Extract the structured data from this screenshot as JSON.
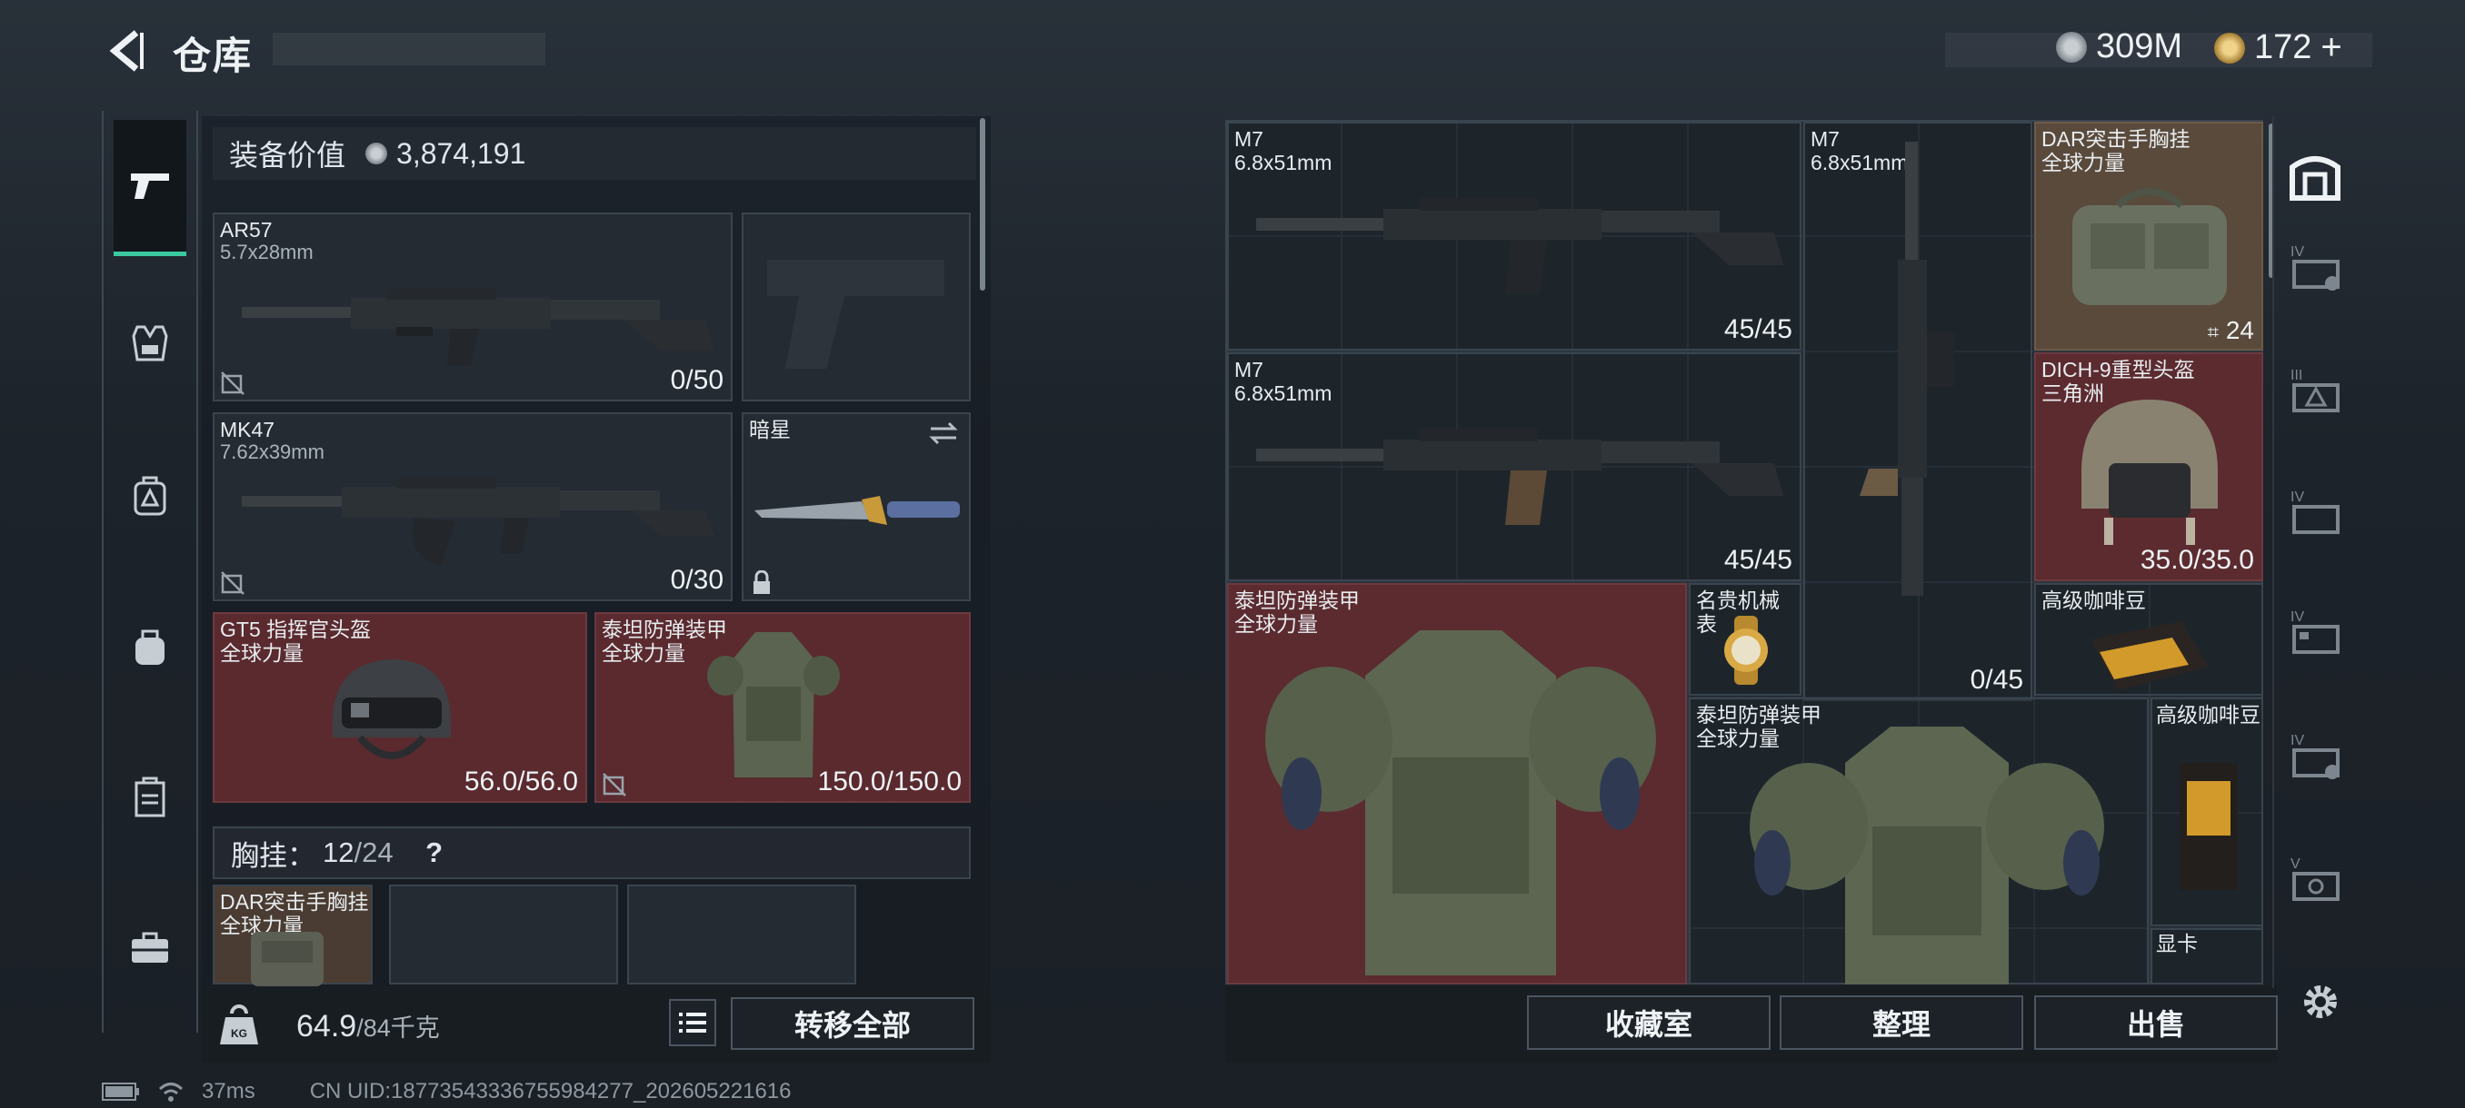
{
  "header": {
    "title": "仓库",
    "silver": "309M",
    "gold": "172"
  },
  "nav": {
    "items": [
      "weapons",
      "armor",
      "backpack",
      "bag",
      "locker",
      "case"
    ]
  },
  "equipment": {
    "label": "装备价值",
    "value": "3,874,191"
  },
  "slots": {
    "primary1": {
      "name": "AR57",
      "ammo": "5.7x28mm",
      "value": "0/50"
    },
    "primary2": {
      "name": "MK47",
      "ammo": "7.62x39mm",
      "value": "0/30"
    },
    "melee": {
      "name": "暗星"
    },
    "helmet": {
      "name": "GT5 指挥官头盔",
      "faction": "全球力量",
      "value": "56.0/56.0"
    },
    "armor": {
      "name": "泰坦防弹装甲",
      "faction": "全球力量",
      "value": "150.0/150.0"
    }
  },
  "rig": {
    "label": "胸挂：",
    "used": "12",
    "total": "/24",
    "help": "?",
    "item_name": "DAR突击手胸挂",
    "item_faction": "全球力量"
  },
  "bottom": {
    "weight": "64.9",
    "weight_max": "/84千克",
    "transfer": "转移全部"
  },
  "storage": {
    "m7a": {
      "name": "M7",
      "ammo": "6.8x51mm",
      "value": "45/45"
    },
    "m7b": {
      "name": "M7",
      "ammo": "6.8x51mm",
      "value": "45/45"
    },
    "m7v": {
      "name": "M7",
      "ammo": "6.8x51mm",
      "value": "0/45"
    },
    "dar": {
      "name": "DAR突击手胸挂",
      "faction": "全球力量",
      "value": "24"
    },
    "dich": {
      "name": "DICH-9重型头盔",
      "faction": "三角洲",
      "value": "35.0/35.0"
    },
    "titan1": {
      "name": "泰坦防弹装甲",
      "faction": "全球力量"
    },
    "watch": {
      "name": "名贵机械表"
    },
    "coffee1": {
      "name": "高级咖啡豆"
    },
    "titan2": {
      "name": "泰坦防弹装甲",
      "faction": "全球力量"
    },
    "coffee2": {
      "name": "高级咖啡豆"
    },
    "gpu": {
      "name": "显卡"
    }
  },
  "actions": {
    "collection": "收藏室",
    "organize": "整理",
    "sell": "出售"
  },
  "status": {
    "ping": "37ms",
    "uid": "CN UID:18773543336755984277_202605221616"
  },
  "colors": {
    "accent": "#3ac8a0",
    "red_slot": "#5a2a2f",
    "tan_slot": "#5a4a3c"
  }
}
